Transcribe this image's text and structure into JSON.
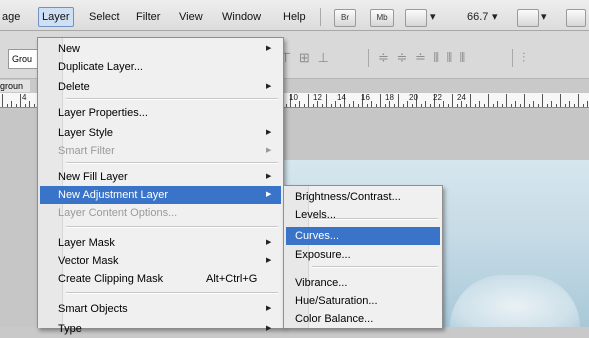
{
  "menubar": {
    "items": [
      "age",
      "Layer",
      "Select",
      "Filter",
      "View",
      "Window",
      "Help"
    ],
    "toolbar": {
      "br_label": "Br",
      "mb_label": "Mb",
      "zoom": "66.7",
      "dropdown_glyph": "▾"
    }
  },
  "options_bar": {
    "auto_select_value": "Grou",
    "align_icons_a": "⊤ ⊞ ⊥",
    "align_icons_b": "≑ ≑ ≐  ⫴ ⫴ ⫴",
    "align_icons_c": "⫶"
  },
  "document": {
    "tab_label": "groun",
    "ruler_numbers": [
      "4",
      "10",
      "12",
      "14",
      "16",
      "18",
      "20",
      "22",
      "24"
    ]
  },
  "layer_menu": {
    "items": [
      {
        "label": "New",
        "submenu": true
      },
      {
        "label": "Duplicate Layer..."
      },
      {
        "label": "Delete",
        "submenu": true
      },
      {
        "label": "Layer Properties..."
      },
      {
        "label": "Layer Style",
        "submenu": true
      },
      {
        "label": "Smart Filter",
        "submenu": true,
        "disabled": true
      },
      {
        "label": "New Fill Layer",
        "submenu": true
      },
      {
        "label": "New Adjustment Layer",
        "submenu": true,
        "highlighted": true
      },
      {
        "label": "Layer Content Options...",
        "disabled": true
      },
      {
        "label": "Layer Mask",
        "submenu": true
      },
      {
        "label": "Vector Mask",
        "submenu": true
      },
      {
        "label": "Create Clipping Mask",
        "shortcut": "Alt+Ctrl+G"
      },
      {
        "label": "Smart Objects",
        "submenu": true
      },
      {
        "label": "Type",
        "submenu": true
      }
    ],
    "submenu_arrow": "▶"
  },
  "adjustment_submenu": {
    "items": [
      {
        "label": "Brightness/Contrast..."
      },
      {
        "label": "Levels..."
      },
      {
        "label": "Curves...",
        "highlighted": true
      },
      {
        "label": "Exposure..."
      },
      {
        "label": "Vibrance..."
      },
      {
        "label": "Hue/Saturation..."
      },
      {
        "label": "Color Balance..."
      }
    ]
  },
  "colors": {
    "highlight": "#3a74c8",
    "menu_bg": "#f0f0f0",
    "disabled_text": "#9a9a9a"
  }
}
